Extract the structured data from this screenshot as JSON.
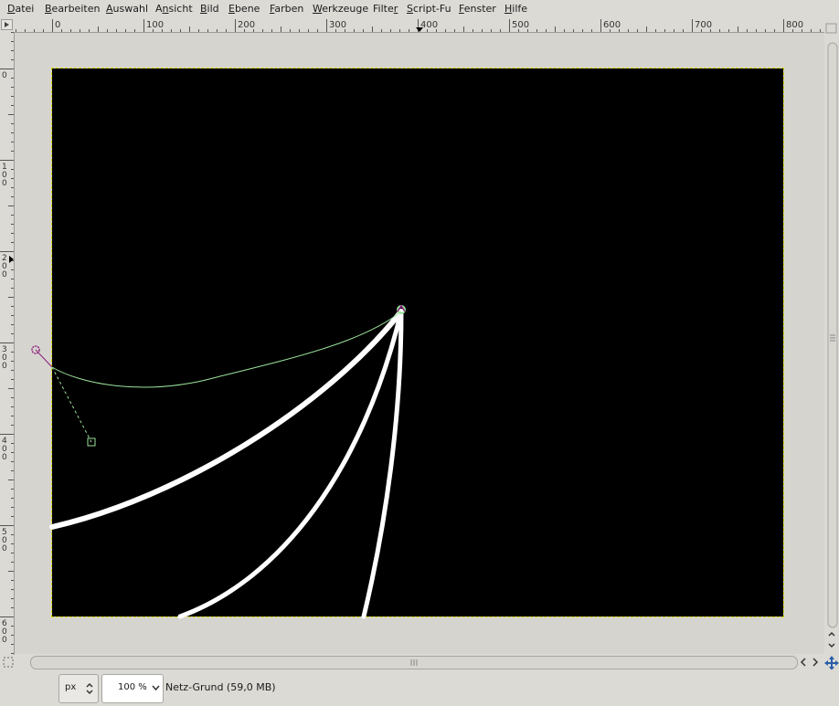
{
  "menubar": {
    "items": [
      {
        "label": "Datei",
        "mnemonic": "D",
        "rest": "atei"
      },
      {
        "label": "Bearbeiten",
        "mnemonic": "B",
        "rest": "earbeiten"
      },
      {
        "label": "Auswahl",
        "mnemonic": "A",
        "rest": "uswahl"
      },
      {
        "label": "Ansicht",
        "pre": "A",
        "mnemonic": "n",
        "rest": "sicht"
      },
      {
        "label": "Bild",
        "mnemonic": "B",
        "rest": "ild"
      },
      {
        "label": "Ebene",
        "mnemonic": "E",
        "rest": "bene"
      },
      {
        "label": "Farben",
        "mnemonic": "F",
        "rest": "arben"
      },
      {
        "label": "Werkzeuge",
        "mnemonic": "W",
        "rest": "erkzeuge"
      },
      {
        "label": "Filter",
        "pre": "Filte",
        "mnemonic": "r",
        "rest": ""
      },
      {
        "label": "Script-Fu",
        "mnemonic": "S",
        "rest": "cript-Fu"
      },
      {
        "label": "Fenster",
        "mnemonic": "F",
        "rest": "enster"
      },
      {
        "label": "Hilfe",
        "mnemonic": "H",
        "rest": "ilfe"
      }
    ]
  },
  "rulers": {
    "horizontal_labels": [
      "0",
      "100",
      "200",
      "300",
      "400",
      "500",
      "600",
      "700",
      "800"
    ],
    "vertical_labels": [
      "0",
      "100",
      "200",
      "300",
      "400",
      "500",
      "600"
    ]
  },
  "statusbar": {
    "unit": "px",
    "zoom": "100 %",
    "status_text": "Netz-Grund (59,0 MB)"
  },
  "colors": {
    "path_color": "#9be29b",
    "handle_color": "#8b1e7a",
    "stroke_color": "#ffffff",
    "selection_color": "#d8d800"
  },
  "icons": {
    "menu_arrow": "small-triangle-icon",
    "navigate": "navigate-cross-icon",
    "quickmask": "quickmask-icon"
  }
}
